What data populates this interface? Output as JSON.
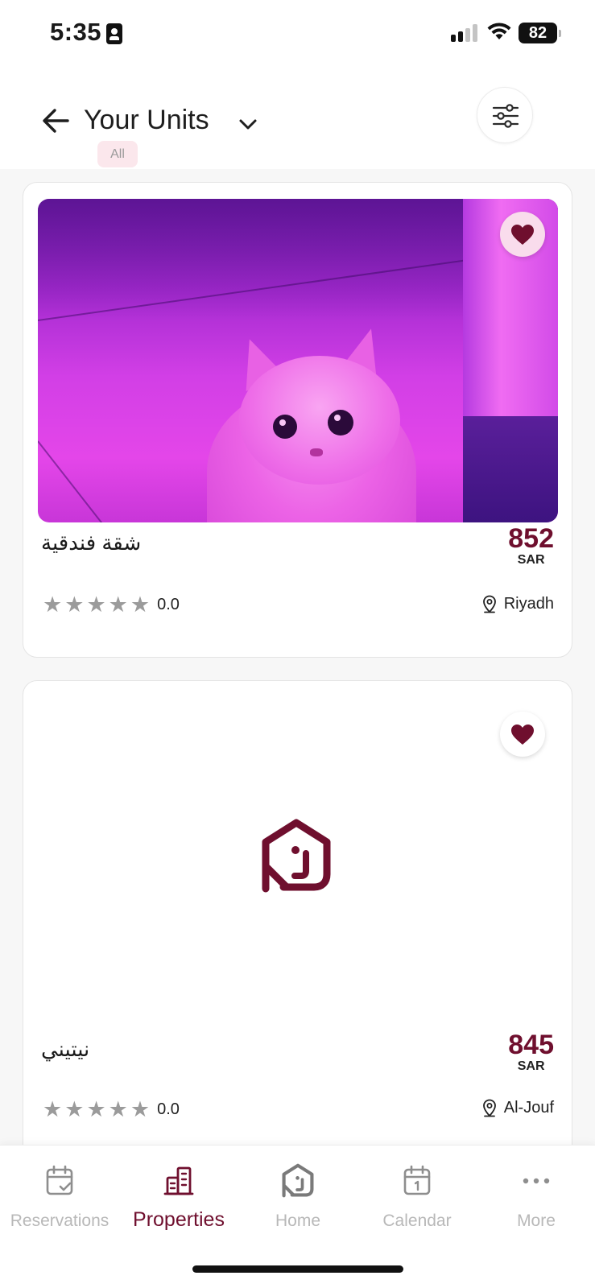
{
  "status_bar": {
    "time": "5:35",
    "battery": "82"
  },
  "header": {
    "title": "Your Units",
    "filter_chip": "All"
  },
  "units": [
    {
      "name": "شقة فندقية",
      "price": "852",
      "currency": "SAR",
      "rating": "0.0",
      "location": "Riyadh",
      "favorited": true,
      "image": "photo"
    },
    {
      "name": "نيتيني",
      "price": "845",
      "currency": "SAR",
      "rating": "0.0",
      "location": "Al-Jouf",
      "favorited": true,
      "image": "placeholder-logo"
    }
  ],
  "nav": {
    "items": [
      {
        "label": "Reservations",
        "icon": "calendar-check-icon",
        "active": false
      },
      {
        "label": "Properties",
        "icon": "buildings-icon",
        "active": true
      },
      {
        "label": "Home",
        "icon": "house-logo-icon",
        "active": false
      },
      {
        "label": "Calendar",
        "icon": "calendar-icon",
        "active": false
      },
      {
        "label": "More",
        "icon": "more-dots-icon",
        "active": false
      }
    ]
  },
  "colors": {
    "brand": "#6f0f2e",
    "inactive": "#b8b8b8",
    "chip_bg": "#fbe7ec",
    "star": "#9b9b9b"
  }
}
